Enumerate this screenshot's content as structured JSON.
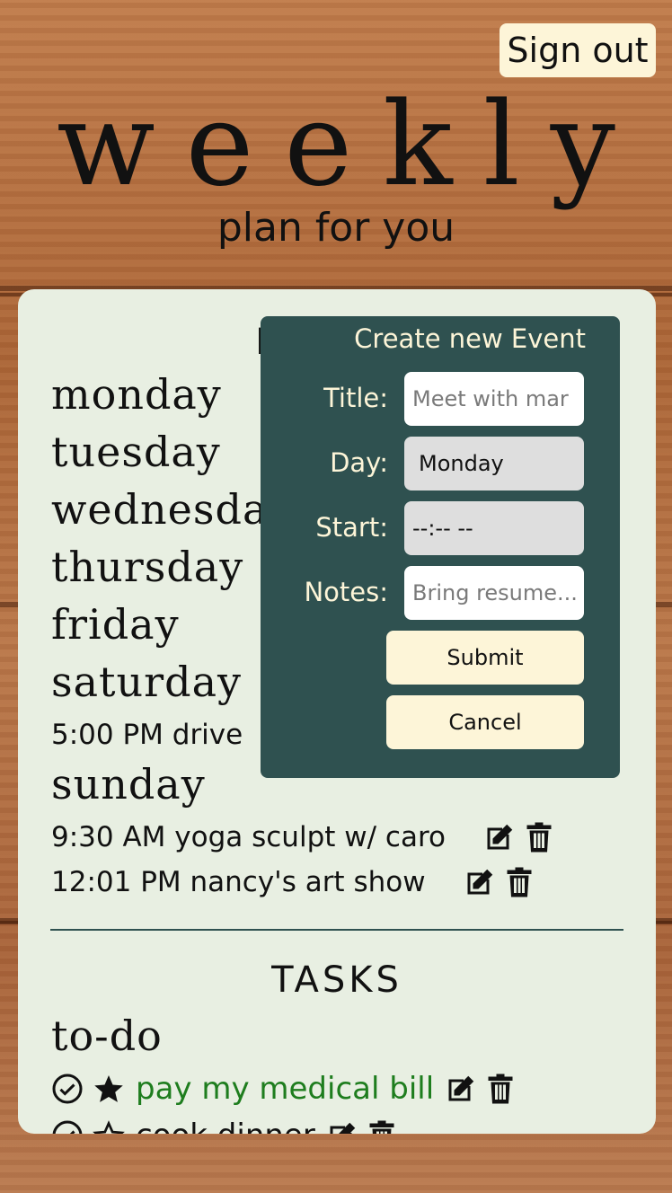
{
  "header": {
    "signout_label": "Sign out",
    "logo": "weekly",
    "tagline": "plan for you"
  },
  "events": {
    "heading": "EVENTS",
    "days": [
      {
        "label": "monday",
        "events": []
      },
      {
        "label": "tuesday",
        "events": []
      },
      {
        "label": "wednesday",
        "events": []
      },
      {
        "label": "thursday",
        "events": []
      },
      {
        "label": "friday",
        "events": []
      },
      {
        "label": "saturday",
        "events": [
          {
            "text": "5:00 PM drive"
          }
        ]
      },
      {
        "label": "sunday",
        "events": [
          {
            "text": "9:30 AM yoga sculpt w/ caro"
          },
          {
            "text": "12:01 PM nancy's art show"
          }
        ]
      }
    ]
  },
  "tasks": {
    "heading": "TASKS",
    "todo_label": "to-do",
    "items": [
      {
        "text": "pay my medical bill",
        "starred": true,
        "color": "#1e7d1e"
      },
      {
        "text": "cook dinner",
        "starred": false,
        "color": "#111111"
      }
    ]
  },
  "modal": {
    "title": "Create new Event",
    "title_label": "Title:",
    "title_placeholder": "Meet with mar",
    "day_label": "Day:",
    "day_value": "Monday",
    "start_label": "Start:",
    "start_value": "--:-- --",
    "notes_label": "Notes:",
    "notes_placeholder": "Bring resume...",
    "submit_label": "Submit",
    "cancel_label": "Cancel"
  },
  "icons": {
    "edit": "edit-icon",
    "delete": "trash-icon",
    "complete": "check-circle-icon",
    "star": "star-icon"
  },
  "colors": {
    "card_bg": "#e8efe2",
    "modal_bg": "#2f5150",
    "button_bg": "#fdf5d8",
    "priority_task": "#1e7d1e"
  }
}
